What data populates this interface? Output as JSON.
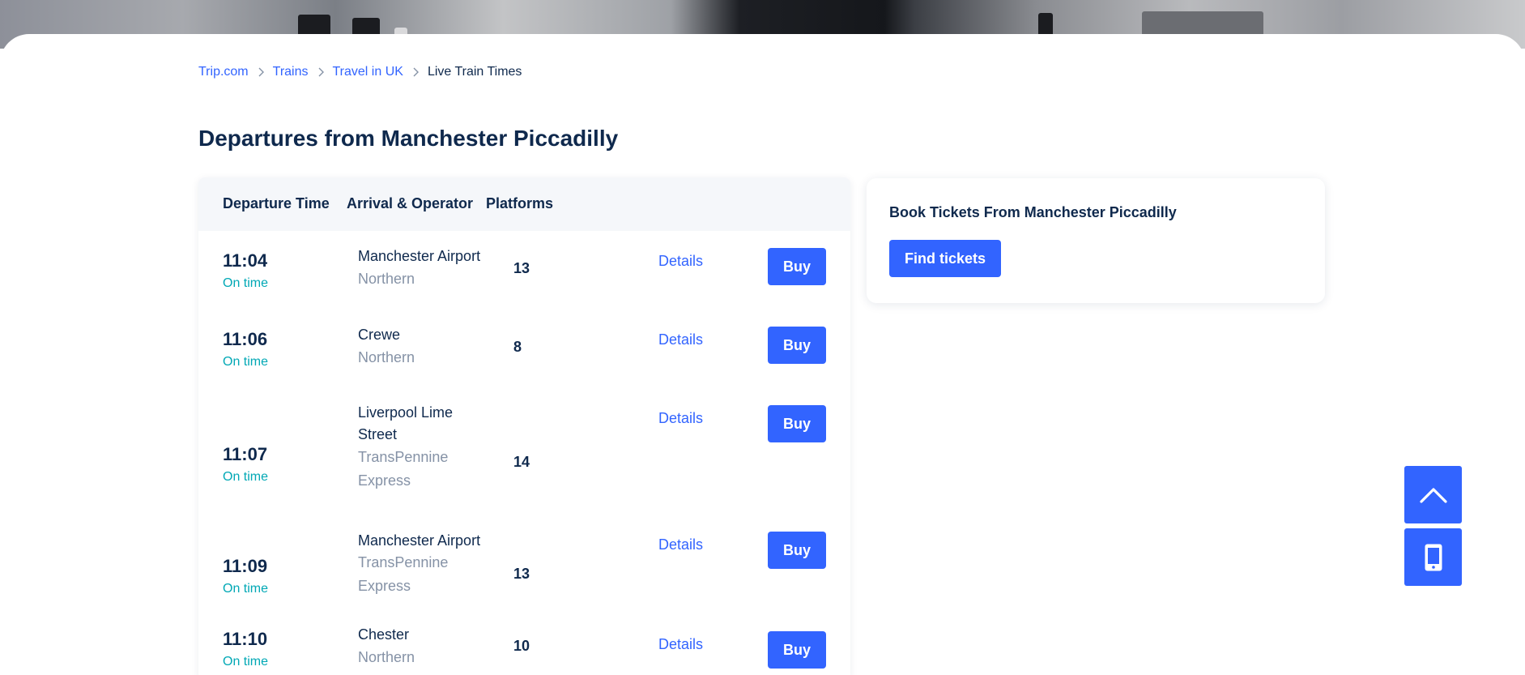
{
  "breadcrumb": {
    "items": [
      "Trip.com",
      "Trains",
      "Travel in UK"
    ],
    "current": "Live Train Times"
  },
  "page_title": "Departures from Manchester Piccadilly",
  "table": {
    "headers": [
      "Departure Time",
      "Arrival & Operator",
      "Platforms"
    ],
    "details_label": "Details",
    "buy_label": "Buy",
    "rows": [
      {
        "time": "11:04",
        "status": "On time",
        "destination": "Manchester Airport",
        "operator": "Northern",
        "platform": "13"
      },
      {
        "time": "11:06",
        "status": "On time",
        "destination": "Crewe",
        "operator": "Northern",
        "platform": "8"
      },
      {
        "time": "11:07",
        "status": "On time",
        "destination": "Liverpool Lime Street",
        "operator": "TransPennine Express",
        "platform": "14"
      },
      {
        "time": "11:09",
        "status": "On time",
        "destination": "Manchester Airport",
        "operator": "TransPennine Express",
        "platform": "13"
      },
      {
        "time": "11:10",
        "status": "On time",
        "destination": "Chester",
        "operator": "Northern",
        "platform": "10"
      }
    ]
  },
  "sidebar": {
    "title": "Book Tickets From Manchester Piccadilly",
    "button_label": "Find tickets"
  },
  "floating": {
    "scroll_top_icon": "chevron-up-icon",
    "app_icon": "mobile-phone-icon"
  },
  "colors": {
    "accent": "#3264ff",
    "text": "#0f294d",
    "muted": "#8592a6",
    "on_time": "#00a8b5"
  }
}
